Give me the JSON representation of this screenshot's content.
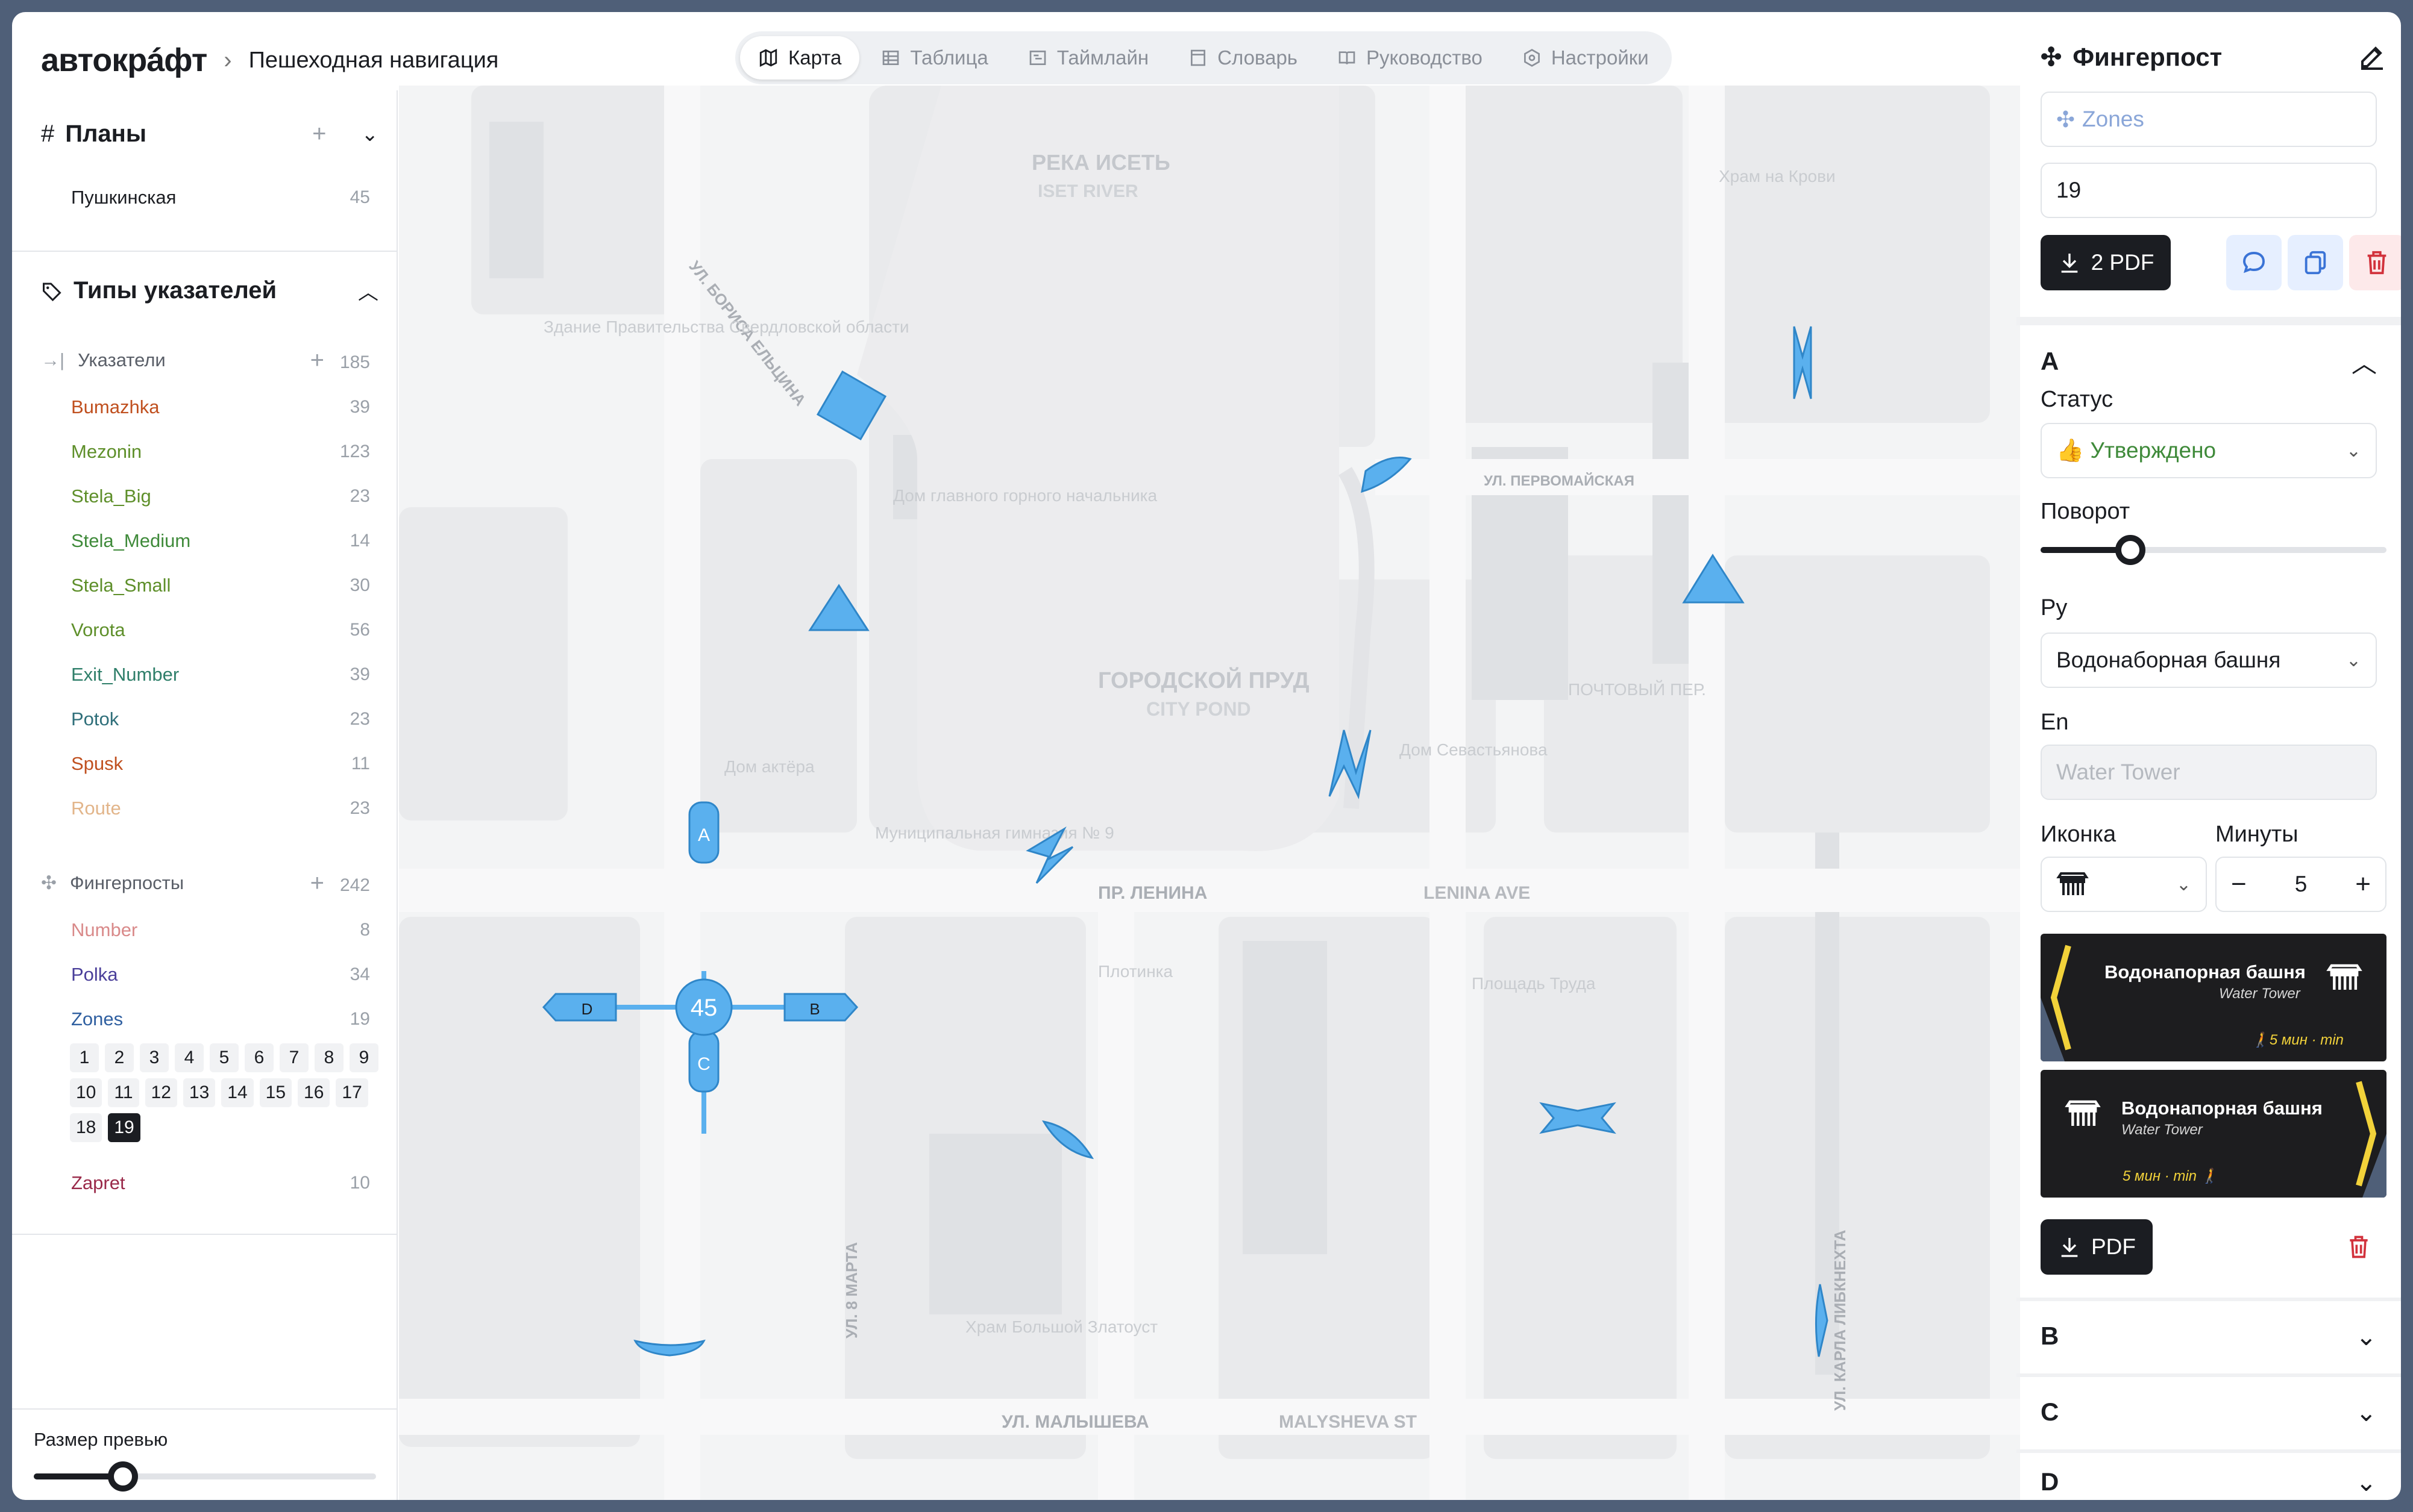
{
  "header": {
    "logo": "автокрáфт",
    "breadcrumb": "Пешеходная навигация",
    "tabs": [
      {
        "label": "Карта",
        "icon": "map-icon",
        "active": true
      },
      {
        "label": "Таблица",
        "icon": "table-icon",
        "active": false
      },
      {
        "label": "Таймлайн",
        "icon": "timeline-icon",
        "active": false
      },
      {
        "label": "Словарь",
        "icon": "dictionary-icon",
        "active": false
      },
      {
        "label": "Руководство",
        "icon": "book-icon",
        "active": false
      },
      {
        "label": "Настройки",
        "icon": "settings-icon",
        "active": false
      }
    ]
  },
  "sidebar": {
    "plans": {
      "title": "Планы",
      "items": [
        {
          "label": "Пушкинская",
          "count": "45"
        }
      ]
    },
    "types": {
      "title": "Типы указателей",
      "pointers": {
        "label": "Указатели",
        "count": "185"
      },
      "items": [
        {
          "label": "Bumazhka",
          "count": "39",
          "color": "#c0501f"
        },
        {
          "label": "Mezonin",
          "count": "123",
          "color": "#5e8f2a"
        },
        {
          "label": "Stela_Big",
          "count": "23",
          "color": "#5e8f2a"
        },
        {
          "label": "Stela_Medium",
          "count": "14",
          "color": "#3f8a3a"
        },
        {
          "label": "Stela_Small",
          "count": "30",
          "color": "#5e8f2a"
        },
        {
          "label": "Vorota",
          "count": "56",
          "color": "#5e8f2a"
        },
        {
          "label": "Exit_Number",
          "count": "39",
          "color": "#2f7f6a"
        },
        {
          "label": "Potok",
          "count": "23",
          "color": "#2f6f7a"
        },
        {
          "label": "Spusk",
          "count": "11",
          "color": "#c0501f"
        },
        {
          "label": "Route",
          "count": "23",
          "color": "#e2b58a"
        }
      ],
      "fingerposts": {
        "label": "Фингерпосты",
        "count": "242"
      },
      "fp_items": [
        {
          "label": "Number",
          "count": "8",
          "color": "#d98a8a"
        },
        {
          "label": "Polka",
          "count": "34",
          "color": "#4a3f9a"
        },
        {
          "label": "Zones",
          "count": "19",
          "color": "#2f5fa0"
        }
      ],
      "zones": [
        "1",
        "2",
        "3",
        "4",
        "5",
        "6",
        "7",
        "8",
        "9",
        "10",
        "11",
        "12",
        "13",
        "14",
        "15",
        "16",
        "17",
        "18",
        "19"
      ],
      "zones_selected": "19",
      "zapret": {
        "label": "Zapret",
        "count": "10",
        "color": "#9a2a4a"
      }
    },
    "preview_size": {
      "label": "Размер превью",
      "value": 0.26
    }
  },
  "map": {
    "labels": [
      "РЕКА ИСЕТЬ",
      "ISET RIVER",
      "ГОРОДСКОЙ ПРУД",
      "CITY POND",
      "ПР. ЛЕНИНА",
      "LENINA AVE",
      "УЛ. МАЛЫШЕВА",
      "MALYSHEVA ST",
      "УЛ. ПЕРВОМАЙСКАЯ",
      "УЛ. БОРИСА ЕЛЬЦИНА",
      "УЛ. 8 МАРТА",
      "УЛ. КАРЛА ЛИБКНЕХТА",
      "Дом главного горного начальника",
      "Храм на Крови",
      "Дом актёра",
      "Муниципальная гимназия № 9",
      "Площадь Труда",
      "Храм Большой Златоуст",
      "Здание Правительства Свердловской области",
      "Дом Севастьянова",
      "ПОЧТОВЫЙ ПЕР.",
      "Плотинка"
    ],
    "hub_label": "45",
    "hub_arms": [
      "A",
      "B",
      "C",
      "D"
    ]
  },
  "panel": {
    "title": "Фингерпост",
    "zones_placeholder": "Zones",
    "number_value": "19",
    "pdf_button": "2 PDF",
    "section_a": "A",
    "status_label": "Статус",
    "status_value": "👍 Утверждено",
    "rotation_label": "Поворот",
    "rotation_value": 0.26,
    "ru_label": "Ру",
    "ru_value": "Водонаборная башня",
    "en_label": "En",
    "en_placeholder": "Water Tower",
    "icon_label": "Иконка",
    "minutes_label": "Минуты",
    "minutes_value": "5",
    "sign1": {
      "ru": "Водонапорная башня",
      "en": "Water Tower",
      "time": "🚶5 мин · min"
    },
    "sign2": {
      "ru": "Водонапорная башня",
      "en": "Water Tower",
      "time": "5 мин · min 🚶"
    },
    "pdf_single": "PDF",
    "section_b": "B",
    "section_c": "C",
    "section_d": "D"
  },
  "colors": {
    "accent": "#5ab0ee",
    "dark": "#1b1d22",
    "sign_arrow": "#f2d23a"
  }
}
